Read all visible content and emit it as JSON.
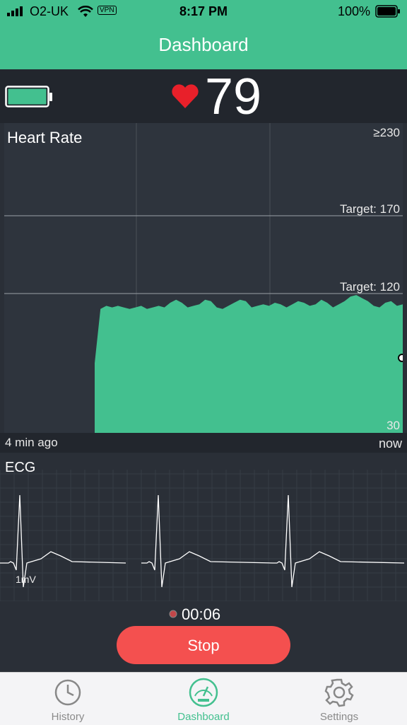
{
  "status_bar": {
    "carrier": "O2-UK",
    "vpn": "VPN",
    "time": "8:17 PM",
    "battery_pct": "100%"
  },
  "header": {
    "title": "Dashboard"
  },
  "stats": {
    "heart_rate": "79",
    "device_battery_level": 1.0
  },
  "chart": {
    "title": "Heart Rate",
    "max_label": "≥230",
    "target_high": "Target: 170",
    "target_low": "Target: 120",
    "min_label": "30",
    "time_start": "4 min ago",
    "time_end": "now"
  },
  "chart_data": {
    "type": "area",
    "title": "Heart Rate",
    "ylim": [
      30,
      230
    ],
    "target_lines": [
      170,
      120
    ],
    "series": [
      {
        "values": [
          75,
          110,
          112,
          111,
          112,
          111,
          110,
          111,
          112,
          110,
          111,
          112,
          111,
          114,
          116,
          114,
          111,
          112,
          113,
          116,
          115,
          111,
          110,
          112,
          114,
          116,
          115,
          111,
          112,
          113,
          112,
          114,
          113,
          111,
          113,
          115,
          114,
          112,
          113,
          116,
          114,
          111,
          113,
          115,
          118,
          119,
          117,
          115,
          112,
          111,
          114,
          115,
          112,
          113
        ]
      }
    ],
    "x_start_label": "4 min ago",
    "x_end_label": "now"
  },
  "ecg": {
    "title": "ECG",
    "scale_label": "1mV"
  },
  "controls": {
    "timer": "00:06",
    "stop_label": "Stop"
  },
  "tabs": [
    {
      "label": "History",
      "icon": "clock-icon",
      "active": false
    },
    {
      "label": "Dashboard",
      "icon": "gauge-icon",
      "active": true
    },
    {
      "label": "Settings",
      "icon": "gear-icon",
      "active": false
    }
  ],
  "colors": {
    "accent": "#43c08f",
    "stop": "#f4504f",
    "heart": "#e8202a",
    "background": "#2a2f37"
  }
}
